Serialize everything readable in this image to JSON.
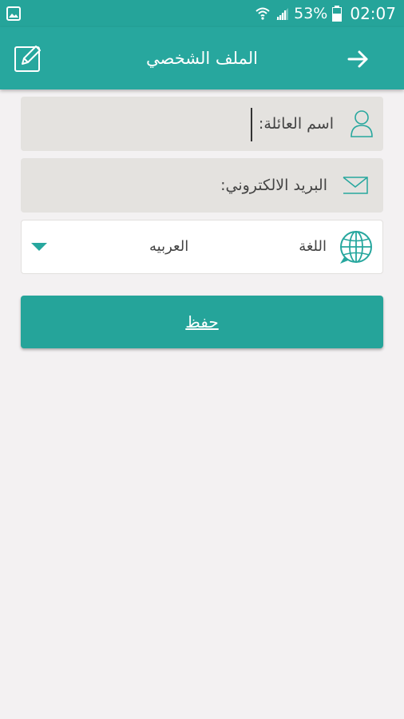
{
  "status_bar": {
    "battery": "53%",
    "time": "02:07"
  },
  "app_bar": {
    "title": "الملف الشخصي"
  },
  "form": {
    "family_name_label": "اسم العائلة:",
    "email_label": "البريد الالكتروني:",
    "language_label": "اللغة",
    "language_value": "العربيه"
  },
  "actions": {
    "save_label": "حفظ"
  },
  "colors": {
    "primary": "#27a79e",
    "background": "#f3f1f2",
    "field_grey": "#e4e2df"
  }
}
